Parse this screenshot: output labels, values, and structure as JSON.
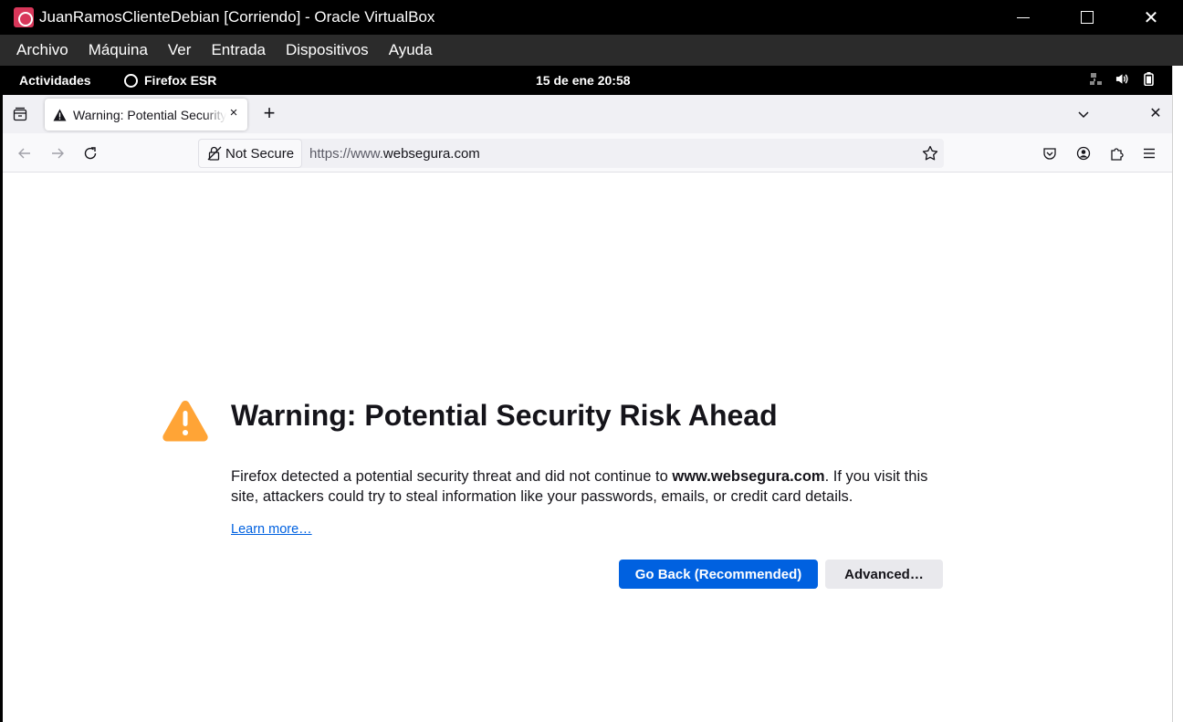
{
  "window": {
    "title": "JuanRamosClienteDebian [Corriendo] - Oracle VirtualBox",
    "controls": {
      "minimize": "minimize",
      "maximize": "maximize",
      "close": "✕"
    }
  },
  "vbox_menu": {
    "items": [
      {
        "label": "Archivo"
      },
      {
        "label": "Máquina"
      },
      {
        "label": "Ver"
      },
      {
        "label": "Entrada"
      },
      {
        "label": "Dispositivos"
      },
      {
        "label": "Ayuda"
      }
    ]
  },
  "gnome": {
    "activities": "Actividades",
    "app_name": "Firefox ESR",
    "clock": "15 de ene  20:58",
    "tray_icons": [
      "network-icon",
      "volume-icon",
      "battery-icon"
    ]
  },
  "firefox": {
    "tab": {
      "title": "Warning: Potential Security Risk Ahead",
      "icon": "warning-icon"
    },
    "new_tab": "+",
    "close_window": "✕",
    "urlbar": {
      "security_label": "Not Secure",
      "url_prefix": "https://www.",
      "url_domain": "websegura.com"
    }
  },
  "page": {
    "title": "Warning: Potential Security Risk Ahead",
    "desc_1": "Firefox detected a potential security threat and did not continue to ",
    "desc_domain": "www.websegura.com",
    "desc_2": ". If you visit this site, attackers could try to steal information like your passwords, emails, or credit card details.",
    "learn_more": "Learn more…",
    "go_back": "Go Back (Recommended)",
    "advanced": "Advanced…"
  },
  "colors": {
    "primary_button": "#0061e0",
    "warning": "#ffa436",
    "link": "#0061e0"
  }
}
